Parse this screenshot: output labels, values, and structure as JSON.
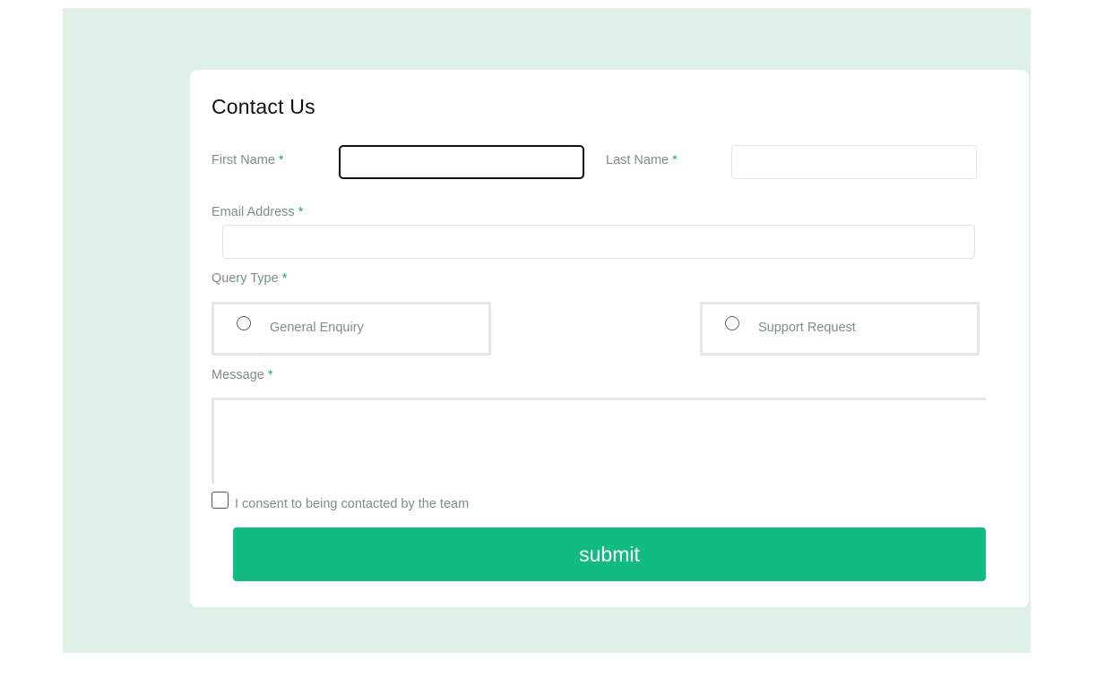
{
  "form": {
    "title": "Contact Us",
    "required_mark": "*",
    "first_name": {
      "label": "First Name",
      "value": ""
    },
    "last_name": {
      "label": "Last Name",
      "value": ""
    },
    "email": {
      "label": "Email Address",
      "value": ""
    },
    "query_type": {
      "label": "Query Type",
      "options": [
        "General Enquiry",
        "Support Request"
      ]
    },
    "message": {
      "label": "Message",
      "value": ""
    },
    "consent": {
      "label": "I consent to being contacted by the team"
    },
    "submit_label": "submit"
  },
  "colors": {
    "backdrop": "#dff0e6",
    "accent": "#12bb82",
    "label_text": "#7c8f8a",
    "required_mark": "#1aa97b"
  }
}
